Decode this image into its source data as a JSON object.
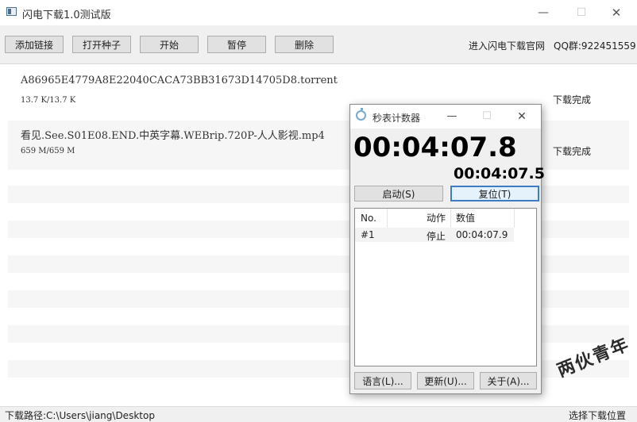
{
  "window": {
    "title": "闪电下载1.0测试版",
    "controls": {
      "minimize": "—",
      "maximize": "☐",
      "close": "✕"
    }
  },
  "toolbar": {
    "buttons": [
      "添加链接",
      "打开种子",
      "开始",
      "暂停",
      "删除"
    ],
    "website_link": "进入闪电下载官网",
    "qq_group": "QQ群:922451559"
  },
  "downloads": [
    {
      "name": "A86965E4779A8E22040CACA73BB31673D14705D8.torrent",
      "size": "13.7 K/13.7 K",
      "status": "下载完成"
    },
    {
      "name": "看见.See.S01E08.END.中英字幕.WEBrip.720P-人人影视.mp4",
      "size": "659 M/659 M",
      "status": "下载完成"
    }
  ],
  "statusbar": {
    "path": "下载路径:C:\\Users\\jiang\\Desktop",
    "choose_location": "选择下载位置"
  },
  "watermark": "两伙青年",
  "stopwatch": {
    "title": "秒表计数器",
    "controls": {
      "minimize": "—",
      "maximize": "☐",
      "close": "✕"
    },
    "main_time": "00:04:07.8",
    "lap_time": "00:04:07.5",
    "start_button": "启动(S)",
    "reset_button": "复位(T)",
    "columns": [
      "No.",
      "动作",
      "数值"
    ],
    "records": [
      {
        "no": "#1",
        "action": "停止",
        "value": "00:04:07.9"
      }
    ],
    "footer_buttons": [
      "语言(L)...",
      "更新(U)...",
      "关于(A)..."
    ]
  },
  "colors": {
    "toolbar_bg": "#f0f0f0",
    "row_stripe": "#f6f6f6",
    "focus_button_border": "#3b7cc4"
  }
}
